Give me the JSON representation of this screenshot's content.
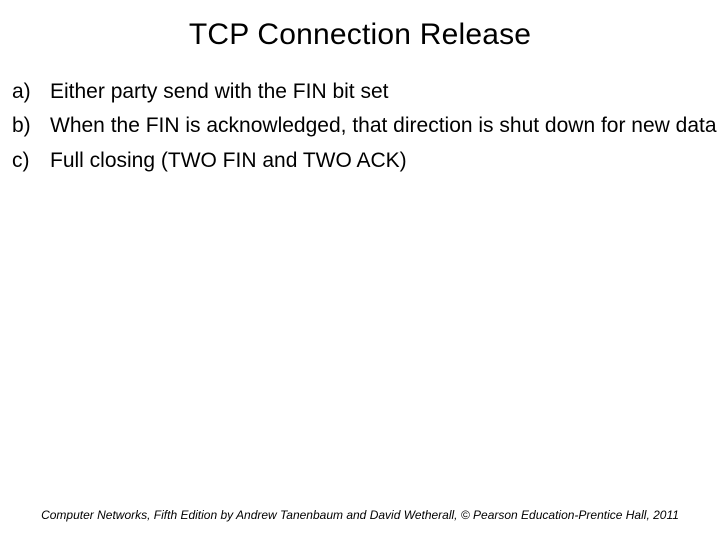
{
  "title": "TCP Connection Release",
  "items": [
    {
      "marker": "a)",
      "text": "Either party send with the FIN bit set"
    },
    {
      "marker": "b)",
      "text": "When the FIN is acknowledged, that direction is shut down for new data"
    },
    {
      "marker": "c)",
      "text": "Full closing (TWO FIN and TWO ACK)"
    }
  ],
  "footer": "Computer Networks, Fifth Edition by Andrew Tanenbaum and David Wetherall, © Pearson Education-Prentice Hall, 2011"
}
